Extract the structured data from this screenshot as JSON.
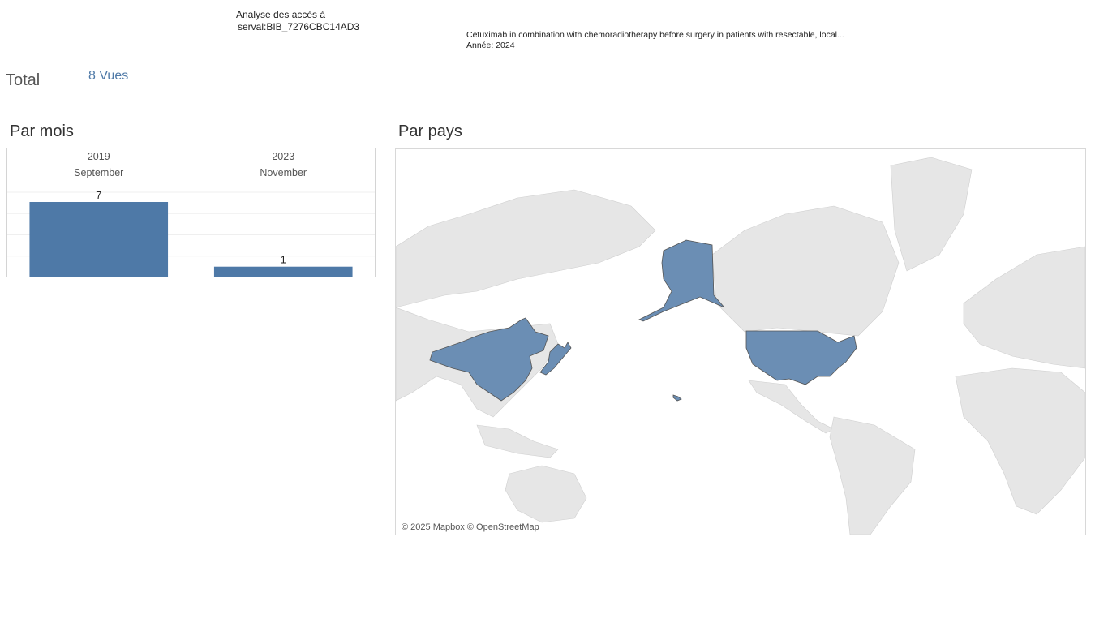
{
  "header": {
    "title_line1": "Analyse des accès à",
    "title_line2": "serval:BIB_7276CBC14AD3",
    "publication_title": "Cetuximab in combination with chemoradiotherapy before surgery in patients with resectable, local...",
    "publication_year": "Année: 2024"
  },
  "total": {
    "label": "Total",
    "value": "8 Vues"
  },
  "sections": {
    "by_month": "Par mois",
    "by_country": "Par pays"
  },
  "chart_data": {
    "type": "bar",
    "categories": [
      "2019 September",
      "2023 November"
    ],
    "years": [
      "2019",
      "2023"
    ],
    "months": [
      "September",
      "November"
    ],
    "values": [
      7,
      1
    ],
    "value_labels": [
      "7",
      "1"
    ],
    "ylim": [
      0,
      7
    ],
    "grid": true,
    "color": "#4e79a7"
  },
  "map": {
    "highlighted_countries": [
      "United States",
      "China",
      "Japan"
    ],
    "fill_color": "#6b8eb4",
    "base_color": "#e8e8e8",
    "attribution": "© 2025 Mapbox © OpenStreetMap"
  }
}
